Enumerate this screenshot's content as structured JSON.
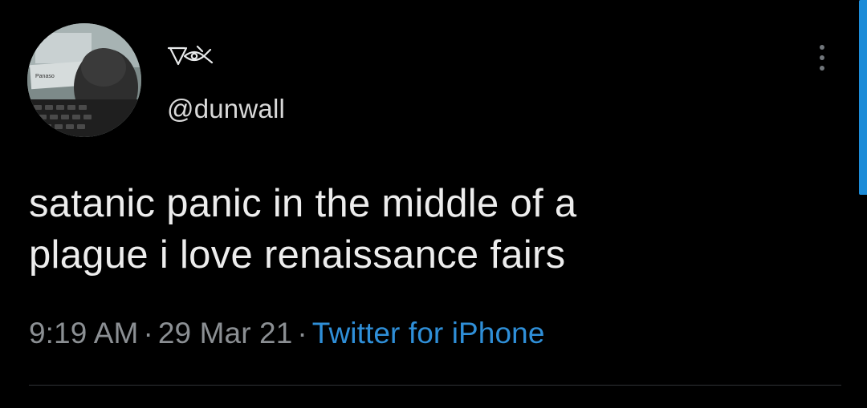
{
  "tweet": {
    "author": {
      "display_name_icon": "eye-glyph-icon",
      "handle": "@dunwall",
      "avatar_label": "Panaso"
    },
    "text_lines": [
      "satanic panic in the middle of a",
      "plague i love renaissance fairs"
    ],
    "time": "9:19 AM",
    "separator": "·",
    "date": "29 Mar 21",
    "source": "Twitter for iPhone",
    "more_icon": "more-vertical-icon"
  },
  "colors": {
    "background": "#000000",
    "text": "#ededed",
    "meta": "#8b8f93",
    "link": "#2f8fd8",
    "scrollbar": "#1d8cd8"
  }
}
